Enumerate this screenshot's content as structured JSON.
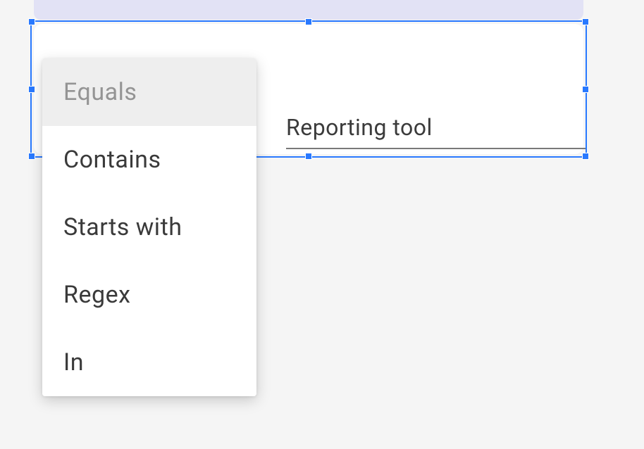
{
  "field": {
    "value": "Reporting tool"
  },
  "dropdown": {
    "items": [
      {
        "label": "Equals",
        "selected": true
      },
      {
        "label": "Contains",
        "selected": false
      },
      {
        "label": "Starts with",
        "selected": false
      },
      {
        "label": "Regex",
        "selected": false
      },
      {
        "label": "In",
        "selected": false
      }
    ]
  }
}
